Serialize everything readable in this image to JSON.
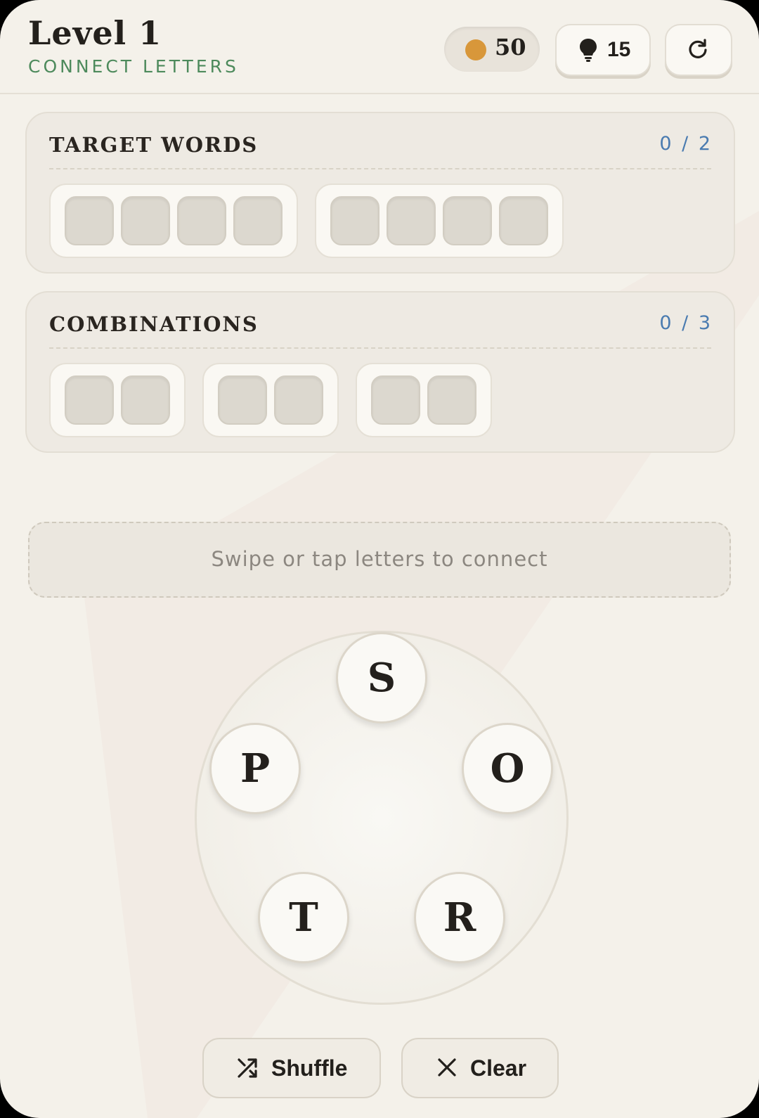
{
  "header": {
    "level_title": "Level 1",
    "subtitle": "CONNECT LETTERS",
    "coins": "50",
    "hints": "15",
    "coin_color": "#d8973a",
    "hint_icon": "lightbulb-icon",
    "refresh_icon": "refresh-icon"
  },
  "target_words": {
    "title": "TARGET WORDS",
    "count": "0 / 2",
    "words": [
      {
        "length": 4
      },
      {
        "length": 4
      }
    ]
  },
  "combinations": {
    "title": "COMBINATIONS",
    "count": "0 / 3",
    "words": [
      {
        "length": 2
      },
      {
        "length": 2
      },
      {
        "length": 2
      }
    ]
  },
  "input": {
    "placeholder": "Swipe or tap letters to connect"
  },
  "wheel": {
    "letters": [
      "S",
      "O",
      "R",
      "T",
      "P"
    ]
  },
  "actions": {
    "shuffle_label": "Shuffle",
    "shuffle_icon": "shuffle-icon",
    "clear_label": "Clear",
    "clear_icon": "close-icon"
  }
}
